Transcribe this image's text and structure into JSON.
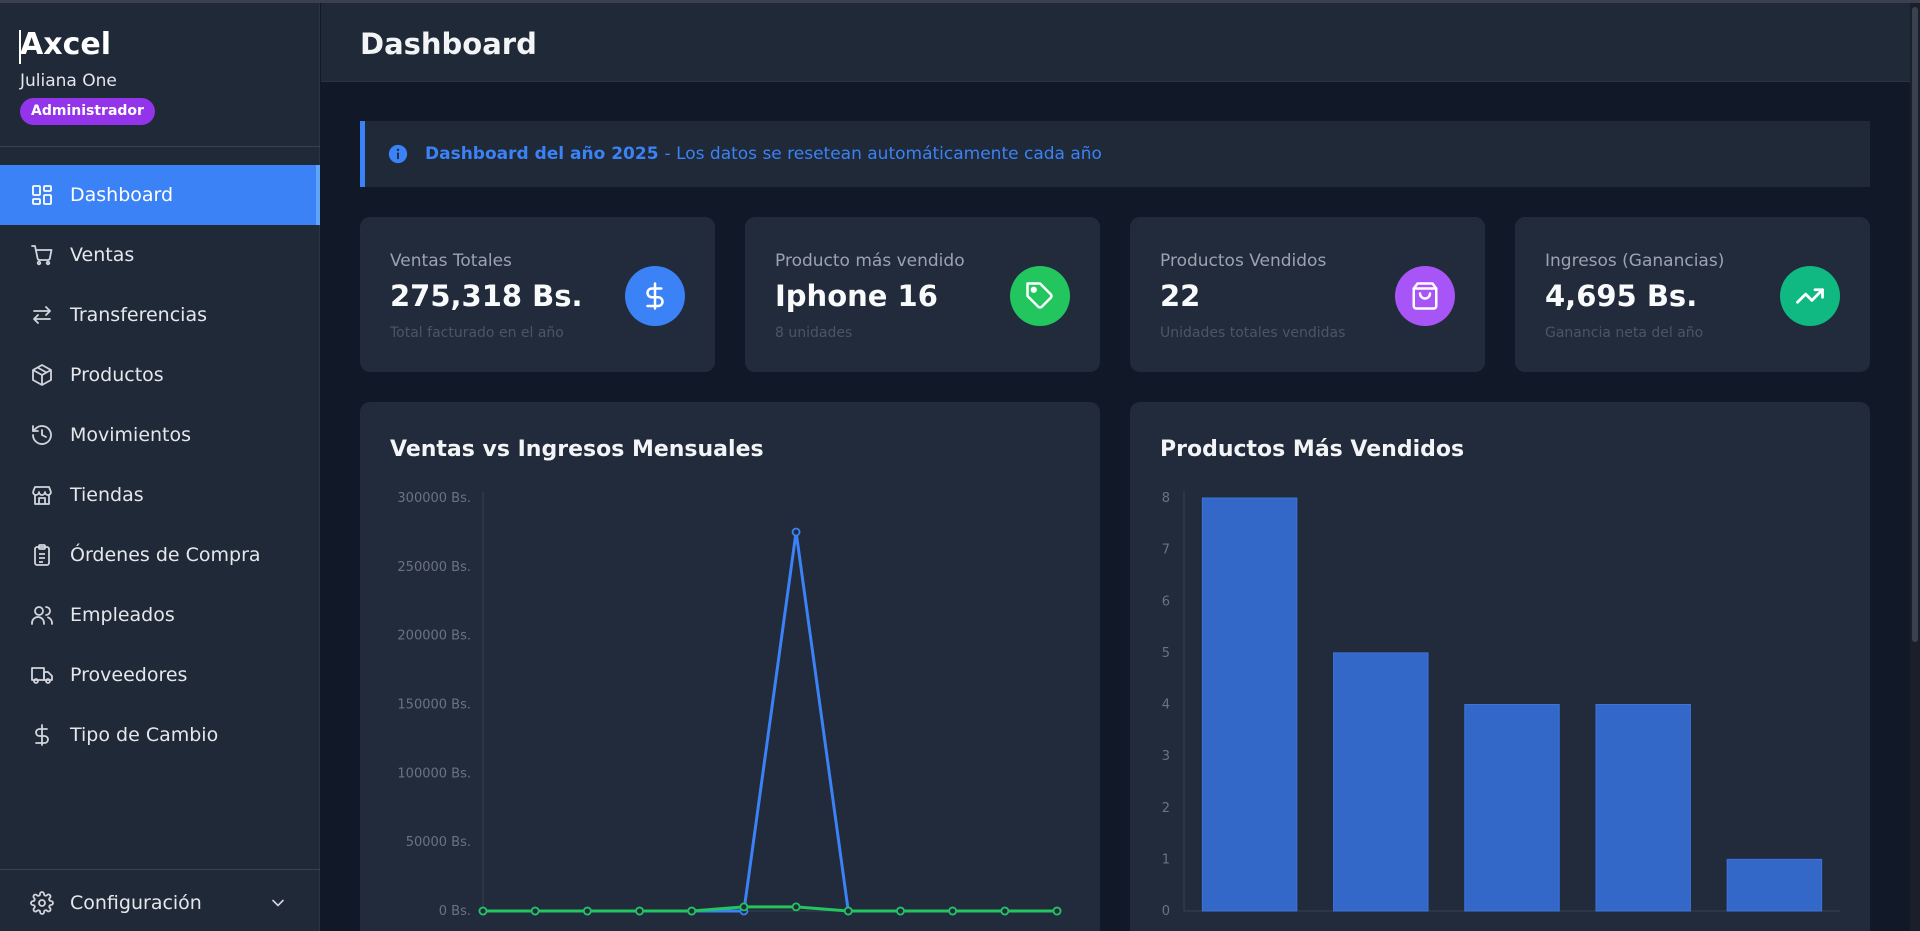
{
  "app": {
    "brand": "Axcel",
    "user": "Juliana One",
    "role": "Administrador"
  },
  "sidebar": {
    "items": [
      {
        "label": "Dashboard",
        "icon": "grid-icon",
        "active": true
      },
      {
        "label": "Ventas",
        "icon": "cart-icon"
      },
      {
        "label": "Transferencias",
        "icon": "arrows-swap-icon"
      },
      {
        "label": "Productos",
        "icon": "box-icon"
      },
      {
        "label": "Movimientos",
        "icon": "history-icon"
      },
      {
        "label": "Tiendas",
        "icon": "store-icon"
      },
      {
        "label": "Órdenes de Compra",
        "icon": "clipboard-icon"
      },
      {
        "label": "Empleados",
        "icon": "users-icon"
      },
      {
        "label": "Proveedores",
        "icon": "truck-icon"
      },
      {
        "label": "Tipo de Cambio",
        "icon": "dollar-icon"
      }
    ],
    "config_label": "Configuración"
  },
  "header": {
    "title": "Dashboard"
  },
  "banner": {
    "bold": "Dashboard del año 2025",
    "text": "- Los datos se resetean automáticamente cada año"
  },
  "stats": [
    {
      "label": "Ventas Totales",
      "value": "275,318 Bs.",
      "sub": "Total facturado en el año",
      "icon": "dollar-icon",
      "color": "#3b82f6"
    },
    {
      "label": "Producto más vendido",
      "value": "Iphone 16",
      "sub": "8 unidades",
      "icon": "tag-icon",
      "color": "#22c55e"
    },
    {
      "label": "Productos Vendidos",
      "value": "22",
      "sub": "Unidades totales vendidas",
      "icon": "shopping-bag-icon",
      "color": "#a855f7"
    },
    {
      "label": "Ingresos (Ganancias)",
      "value": "4,695 Bs.",
      "sub": "Ganancia neta del año",
      "icon": "trending-up-icon",
      "color": "#10b981"
    }
  ],
  "chart_data": [
    {
      "type": "line",
      "title": "Ventas vs Ingresos Mensuales",
      "ylim": [
        0,
        300000
      ],
      "yticks": [
        "300000 Bs.",
        "250000 Bs.",
        "200000 Bs.",
        "150000 Bs.",
        "100000 Bs.",
        "50000 Bs.",
        "0 Bs."
      ],
      "x_count": 12,
      "series": [
        {
          "color": "#3b82f6",
          "values": [
            0,
            0,
            0,
            0,
            0,
            0,
            275318,
            0,
            0,
            0,
            0,
            0
          ]
        },
        {
          "color": "#22c55e",
          "values": [
            0,
            0,
            0,
            0,
            0,
            3000,
            3000,
            0,
            0,
            0,
            0,
            0
          ]
        }
      ],
      "grid": false
    },
    {
      "type": "bar",
      "title": "Productos Más Vendidos",
      "ylim": [
        0,
        8
      ],
      "yticks": [
        "8",
        "7",
        "6",
        "5",
        "4",
        "3",
        "2",
        "1",
        "0"
      ],
      "values": [
        8,
        5,
        4,
        4,
        1
      ],
      "bar_color": "#3468c8"
    }
  ]
}
